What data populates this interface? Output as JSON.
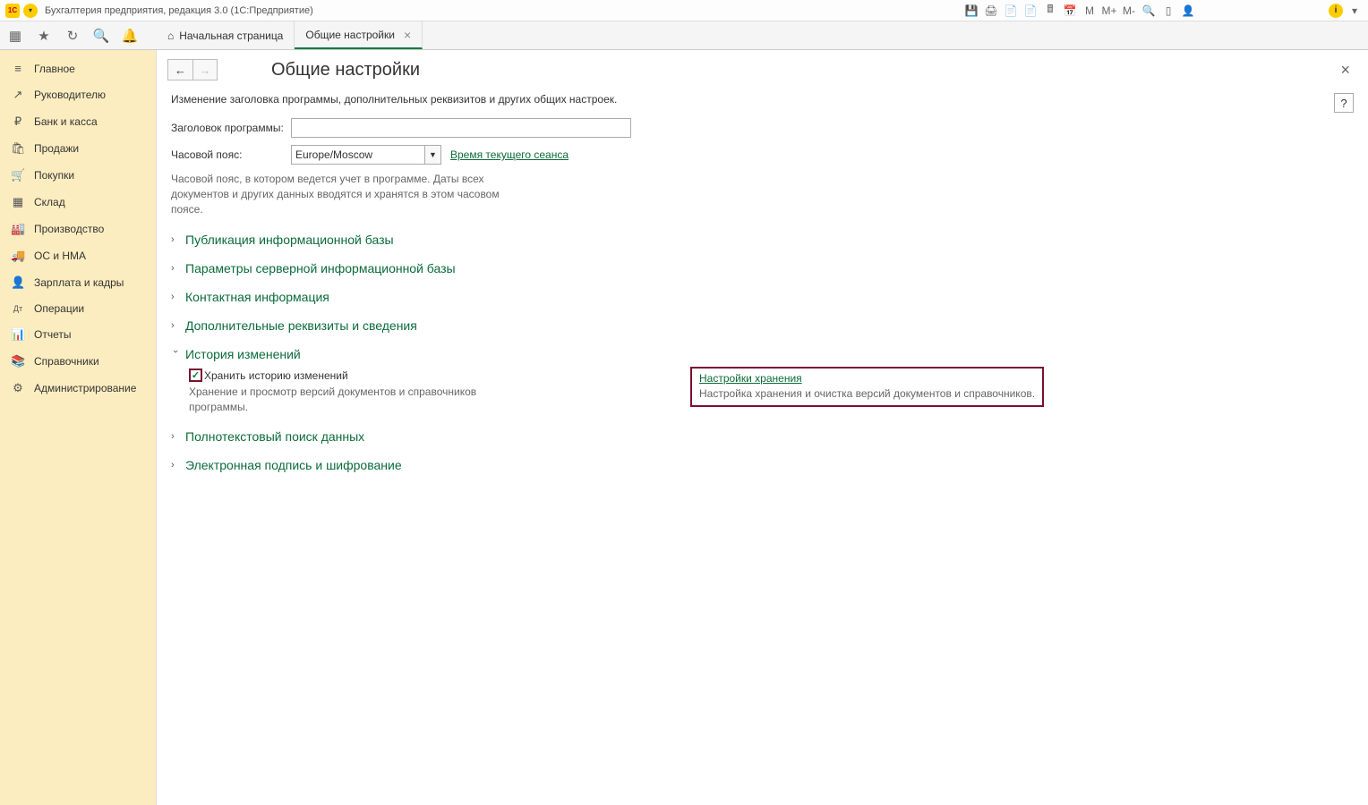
{
  "titlebar": {
    "app_title": "Бухгалтерия предприятия, редакция 3.0   (1С:Предприятие)",
    "icons": {
      "m": "M",
      "mplus": "M+",
      "mminus": "M-"
    }
  },
  "tabs": {
    "home": "Начальная страница",
    "active": "Общие настройки"
  },
  "sidebar": {
    "items": [
      {
        "icon": "≡",
        "label": "Главное"
      },
      {
        "icon": "↗",
        "label": "Руководителю"
      },
      {
        "icon": "₽",
        "label": "Банк и касса"
      },
      {
        "icon": "🛍",
        "label": "Продажи"
      },
      {
        "icon": "🛒",
        "label": "Покупки"
      },
      {
        "icon": "▦",
        "label": "Склад"
      },
      {
        "icon": "🏭",
        "label": "Производство"
      },
      {
        "icon": "🚚",
        "label": "ОС и НМА"
      },
      {
        "icon": "👤",
        "label": "Зарплата и кадры"
      },
      {
        "icon": "Дт",
        "label": "Операции"
      },
      {
        "icon": "📊",
        "label": "Отчеты"
      },
      {
        "icon": "📚",
        "label": "Справочники"
      },
      {
        "icon": "⚙",
        "label": "Администрирование"
      }
    ]
  },
  "page": {
    "title": "Общие настройки",
    "description": "Изменение заголовка программы, дополнительных реквизитов и других общих настроек.",
    "help": "?",
    "fields": {
      "program_title_label": "Заголовок программы:",
      "program_title_value": "",
      "timezone_label": "Часовой пояс:",
      "timezone_value": "Europe/Moscow",
      "session_time_link": "Время текущего сеанса",
      "timezone_hint": "Часовой пояс, в котором ведется учет в программе. Даты всех документов и других данных вводятся и хранятся в этом часовом поясе."
    },
    "sections": {
      "s1": "Публикация информационной базы",
      "s2": "Параметры серверной информационной базы",
      "s3": "Контактная информация",
      "s4": "Дополнительные реквизиты и сведения",
      "s5_title": "История изменений",
      "s5": {
        "checkbox_label": "Хранить историю изменений",
        "checkbox_desc": "Хранение и просмотр версий документов и справочников программы.",
        "settings_link": "Настройки хранения",
        "settings_desc": "Настройка хранения и очистка версий документов и справочников."
      },
      "s6": "Полнотекстовый поиск данных",
      "s7": "Электронная подпись и шифрование"
    }
  }
}
